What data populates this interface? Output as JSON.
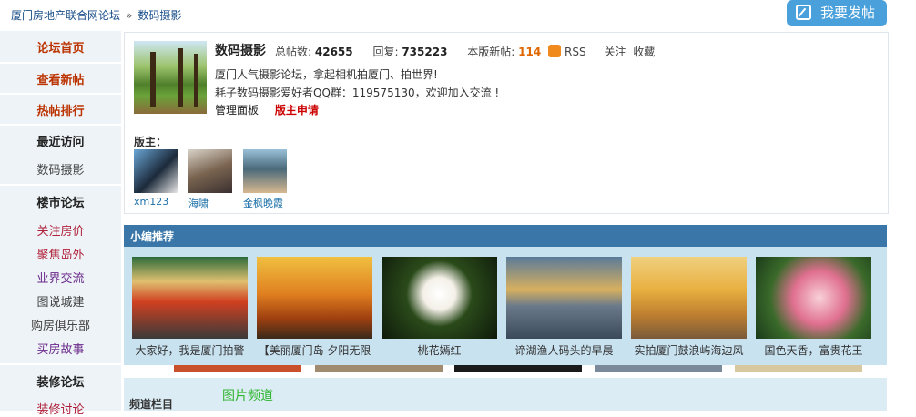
{
  "breadcrumb": {
    "root": "厦门房地产联合网论坛",
    "separator": "»",
    "current": "数码摄影"
  },
  "post_button": {
    "label": "我要发帖"
  },
  "sidebar": {
    "items": [
      {
        "label": "论坛首页"
      },
      {
        "label": "查看新帖"
      },
      {
        "label": "热帖排行"
      },
      {
        "label": "最近访问"
      },
      {
        "label": "数码摄影"
      },
      {
        "label": "楼市论坛"
      },
      {
        "label": "关注房价"
      },
      {
        "label": "聚焦岛外"
      },
      {
        "label": "业界交流"
      },
      {
        "label": "图说城建"
      },
      {
        "label": "购房俱乐部"
      },
      {
        "label": "买房故事"
      },
      {
        "label": "装修论坛"
      },
      {
        "label": "装修讨论"
      }
    ]
  },
  "forum": {
    "title": "数码摄影",
    "posts_label": "总帖数:",
    "posts_value": "42655",
    "replies_label": "回复:",
    "replies_value": "735223",
    "new_label": "本版新帖:",
    "new_value": "114",
    "rss_label": "RSS",
    "follow_label": "关注",
    "fav_label": "收藏",
    "desc1": "厦门人气摄影论坛，拿起相机拍厦门、拍世界!",
    "desc2": "耗子数码摄影爱好者QQ群：119575130，欢迎加入交流 !",
    "admin_label": "管理面板",
    "apply_label": "版主申请",
    "moderators_label": "版主：",
    "moderators": [
      {
        "name": "xm123"
      },
      {
        "name": "海啸"
      },
      {
        "name": "金枫晚霞"
      }
    ]
  },
  "featured": {
    "title": "小编推荐",
    "items": [
      {
        "caption": "大家好，我是厦门拍警"
      },
      {
        "caption": "【美丽厦门岛 夕阳无限"
      },
      {
        "caption": "桃花嫣红"
      },
      {
        "caption": "谛湖渔人码头的早晨"
      },
      {
        "caption": "实拍厦门鼓浪屿海边风"
      },
      {
        "caption": "国色天香，富贵花王"
      }
    ]
  },
  "channel": {
    "column_label": "频道栏目",
    "picture_label": "图片频道"
  },
  "colors": {
    "accent": "#3a77a8",
    "button": "#4aa0db",
    "hot": "#bb3300",
    "link": "#1a6fa8"
  }
}
